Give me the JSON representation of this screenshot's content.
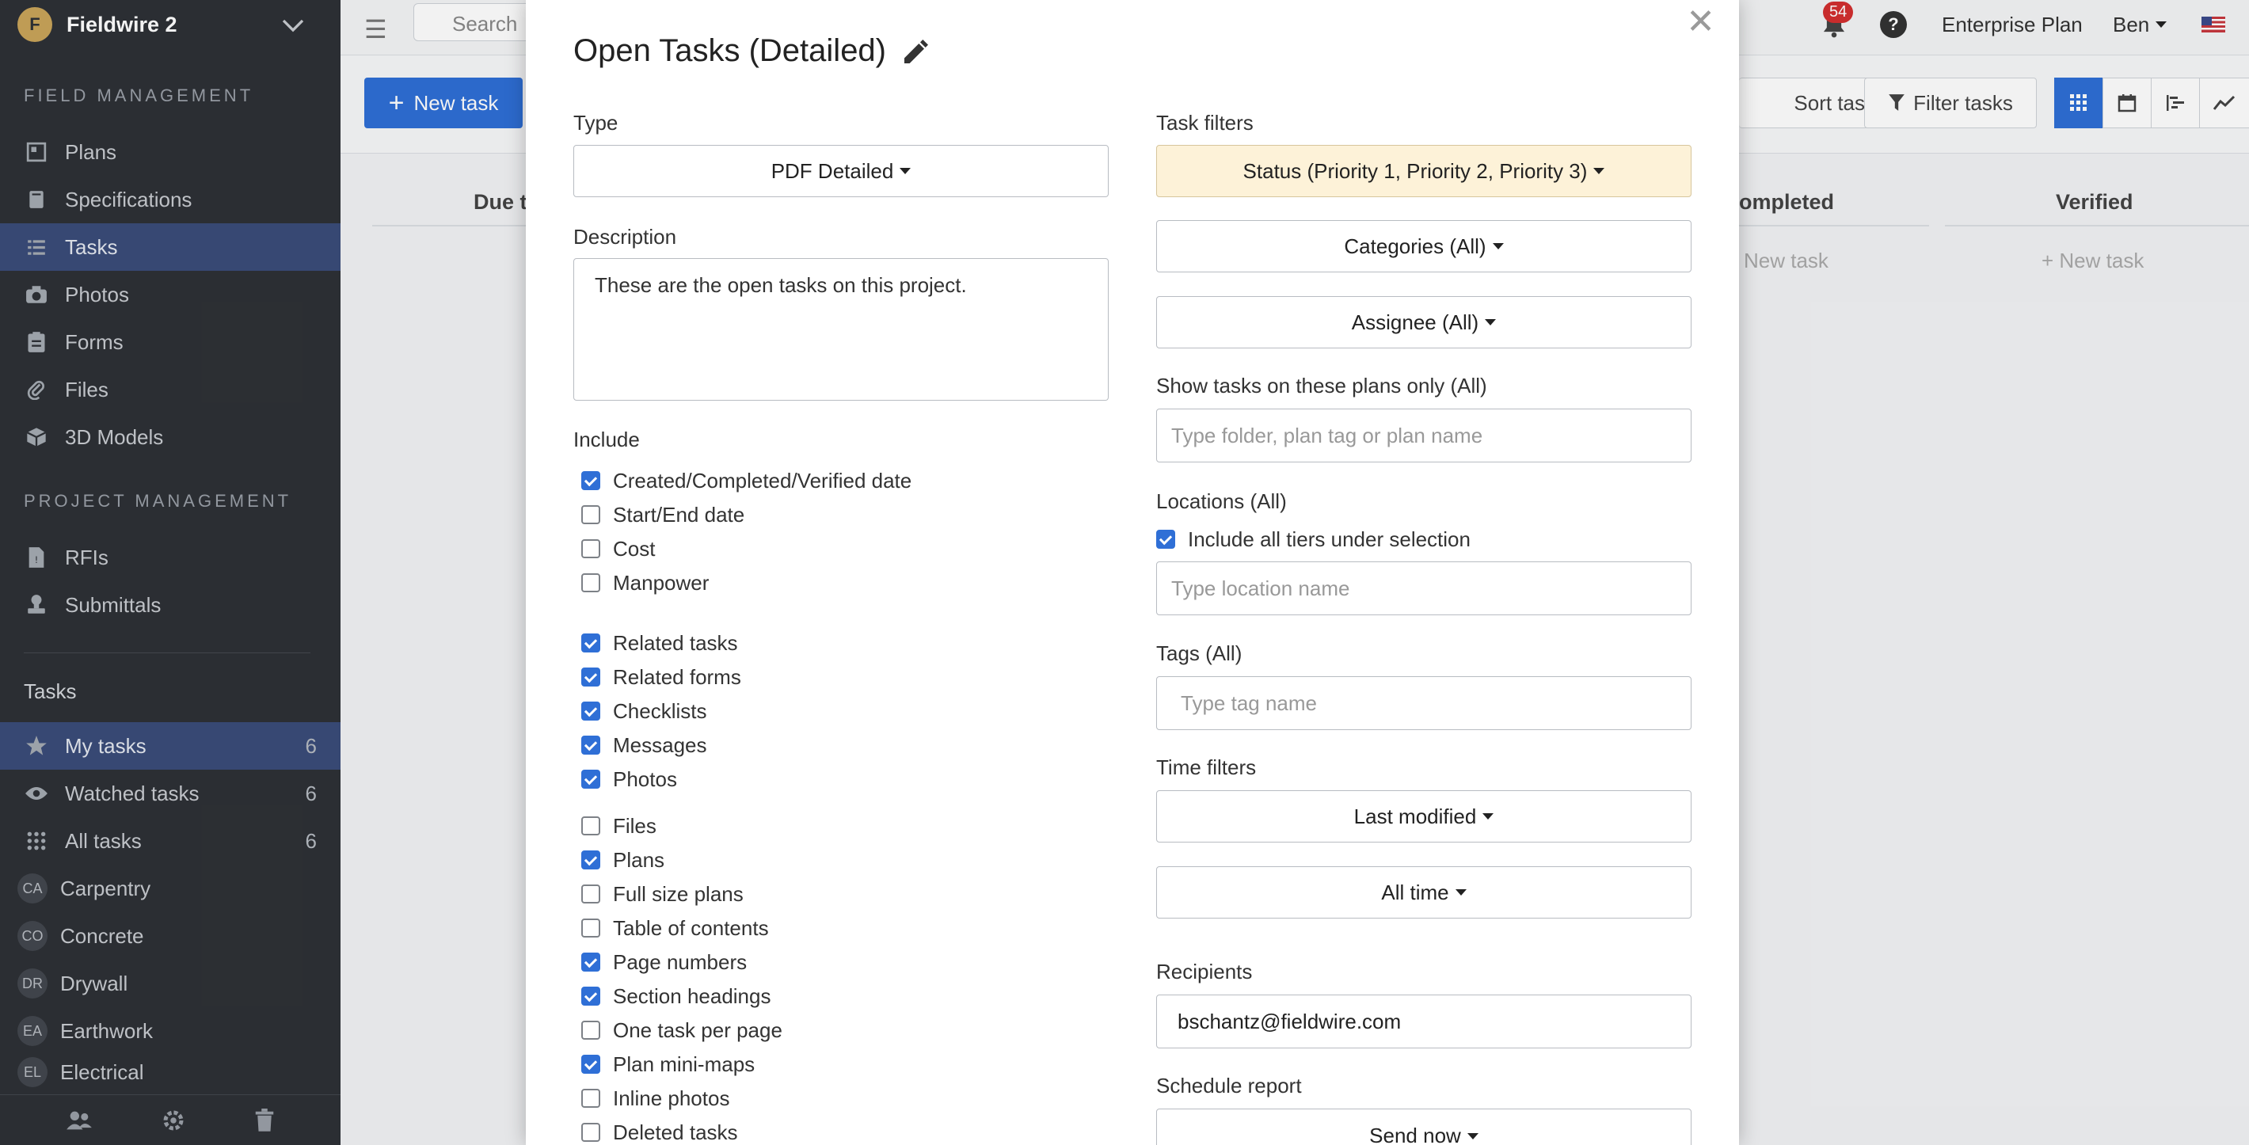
{
  "sidebar": {
    "project_name": "Fieldwire 2",
    "field_management_title": "FIELD MANAGEMENT",
    "field_items": [
      {
        "label": "Plans"
      },
      {
        "label": "Specifications"
      },
      {
        "label": "Tasks"
      },
      {
        "label": "Photos"
      },
      {
        "label": "Forms"
      },
      {
        "label": "Files"
      },
      {
        "label": "3D Models"
      }
    ],
    "project_management_title": "PROJECT MANAGEMENT",
    "project_items": [
      {
        "label": "RFIs"
      },
      {
        "label": "Submittals"
      }
    ],
    "tasks_title": "Tasks",
    "task_lists": [
      {
        "label": "My tasks",
        "count": "6"
      },
      {
        "label": "Watched tasks",
        "count": "6"
      },
      {
        "label": "All tasks",
        "count": "6"
      }
    ],
    "categories": [
      {
        "abbr": "CA",
        "label": "Carpentry"
      },
      {
        "abbr": "CO",
        "label": "Concrete"
      },
      {
        "abbr": "DR",
        "label": "Drywall"
      },
      {
        "abbr": "EA",
        "label": "Earthwork"
      },
      {
        "abbr": "EL",
        "label": "Electrical"
      }
    ]
  },
  "topbar": {
    "search_placeholder": "Search",
    "notification_count": "54",
    "plan_label": "Enterprise Plan",
    "user_name": "Ben"
  },
  "toolbar": {
    "new_task_label": "New task",
    "sort_label": "Sort tasks",
    "filter_label": "Filter tasks"
  },
  "board": {
    "columns": [
      {
        "label": "Due t"
      },
      {
        "label": "ompleted",
        "new_label": "New task"
      },
      {
        "label": "Verified",
        "new_label": "+ New task"
      }
    ]
  },
  "modal": {
    "title": "Open Tasks (Detailed)",
    "type_label": "Type",
    "type_value": "PDF Detailed",
    "description_label": "Description",
    "description_value": "These are the open tasks on this project.",
    "include_label": "Include",
    "include_options": [
      {
        "label": "Created/Completed/Verified date",
        "checked": true
      },
      {
        "label": "Start/End date",
        "checked": false
      },
      {
        "label": "Cost",
        "checked": false
      },
      {
        "label": "Manpower",
        "checked": false
      },
      {
        "label": "Related tasks",
        "checked": true
      },
      {
        "label": "Related forms",
        "checked": true
      },
      {
        "label": "Checklists",
        "checked": true
      },
      {
        "label": "Messages",
        "checked": true
      },
      {
        "label": "Photos",
        "checked": true
      },
      {
        "label": "Files",
        "checked": false
      },
      {
        "label": "Plans",
        "checked": true
      },
      {
        "label": "Full size plans",
        "checked": false
      },
      {
        "label": "Table of contents",
        "checked": false
      },
      {
        "label": "Page numbers",
        "checked": true
      },
      {
        "label": "Section headings",
        "checked": true
      },
      {
        "label": "One task per page",
        "checked": false
      },
      {
        "label": "Plan mini-maps",
        "checked": true
      },
      {
        "label": "Inline photos",
        "checked": false
      },
      {
        "label": "Deleted tasks",
        "checked": false
      }
    ],
    "task_filters_label": "Task filters",
    "status_filter": "Status (Priority 1, Priority 2, Priority 3)",
    "categories_filter": "Categories (All)",
    "assignee_filter": "Assignee (All)",
    "plans_label": "Show tasks on these plans only (All)",
    "plans_placeholder": "Type folder, plan tag or plan name",
    "locations_label": "Locations (All)",
    "include_tiers_label": "Include all tiers under selection",
    "include_tiers_checked": true,
    "location_placeholder": "Type location name",
    "tags_label": "Tags (All)",
    "tag_placeholder": "Type tag name",
    "time_filters_label": "Time filters",
    "time_field_value": "Last modified",
    "time_range_value": "All time",
    "recipients_label": "Recipients",
    "recipients_value": "bschantz@fieldwire.com",
    "schedule_label": "Schedule report",
    "schedule_value": "Send now"
  },
  "colors": {
    "sidebar_bg": "#2e3136",
    "sidebar_active": "#3a4c7a",
    "accent": "#2f6fd6",
    "filter_highlight": "#fdf2d8"
  }
}
